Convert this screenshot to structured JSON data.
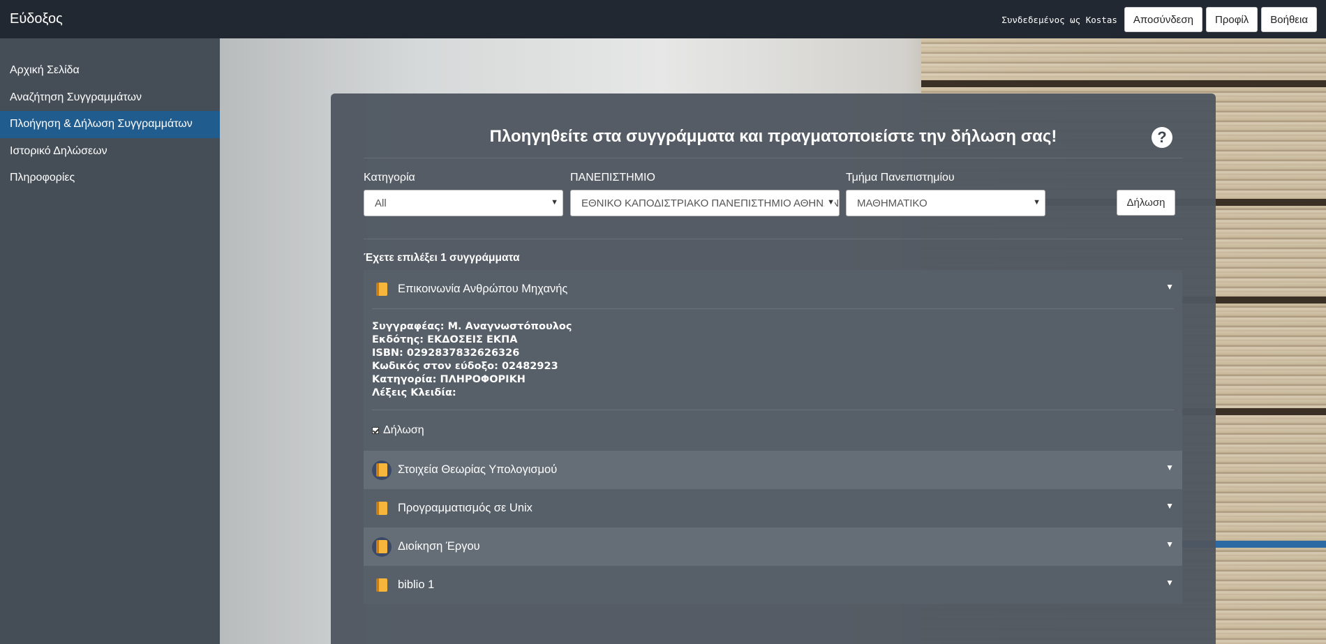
{
  "navbar": {
    "brand": "Εύδοξος",
    "logged_in_text": "Συνδεδεμένος ως Kostas",
    "logout_label": "Αποσύνδεση",
    "profile_label": "Προφίλ",
    "help_label": "Βοήθεια"
  },
  "sidebar": {
    "items": [
      {
        "label": "Αρχική Σελίδα"
      },
      {
        "label": "Αναζήτηση Συγγραμμάτων"
      },
      {
        "label": "Πλοήγηση & Δήλωση Συγγραμμάτων"
      },
      {
        "label": "Ιστορικό Δηλώσεων"
      },
      {
        "label": "Πληροφορίες"
      }
    ]
  },
  "panel": {
    "title": "Πλοηγηθείτε στα συγγράμματα και πραγματοποιείστε την δήλωση σας!",
    "help_icon": "?",
    "filters": {
      "category_label": "Κατηγορία",
      "category_value": "All",
      "university_label": "ΠΑΝΕΠΙΣΤΗΜΙΟ",
      "university_value": "ΕΘΝΙΚΟ ΚΑΠΟΔΙΣΤΡΙΑΚΟ ΠΑΝΕΠΙΣΤΗΜΙΟ ΑΘΗΝΩΝ",
      "department_label": "Τμήμα Πανεπιστημίου",
      "department_value": "ΜΑΘΗΜΑΤΙΚΟ",
      "arrow": "▼"
    },
    "declare_button": "Δήλωση",
    "selected_count_text": "Έχετε επιλέξει 1 συγγράμματα",
    "books": [
      {
        "title": "Επικοινωνία Ανθρώπου Μηχανής",
        "details": {
          "author": "Συγγραφέας: Μ. Αναγνωστόπουλος",
          "publisher": "Εκδότης: ΕΚΔΟΣΕΙΣ ΕΚΠΑ",
          "isbn": "ISBN: 0292837832626326",
          "code": "Κωδικός στον εύδοξο: 02482923",
          "category": "Κατηγορία: ΠΛΗΡΟΦΟΡΙΚΗ",
          "keywords": "Λέξεις Κλειδία:"
        },
        "declare_label": "Δήλωση",
        "declared": true
      },
      {
        "title": "Στοιχεία Θεωρίας Υπολογισμού"
      },
      {
        "title": "Προγραμματισμός σε Unix"
      },
      {
        "title": "Διοίκηση Έργου"
      },
      {
        "title": "biblio 1"
      }
    ],
    "caret": "▼"
  },
  "icons": {
    "book_icon": "book-icon",
    "help_icon": "question-circle-icon",
    "caret_icon": "caret-down-icon"
  },
  "colors": {
    "navbar": "#222831",
    "sidebar": "#454d57",
    "active_item": "#215c8f",
    "panel": "#4f5660"
  }
}
